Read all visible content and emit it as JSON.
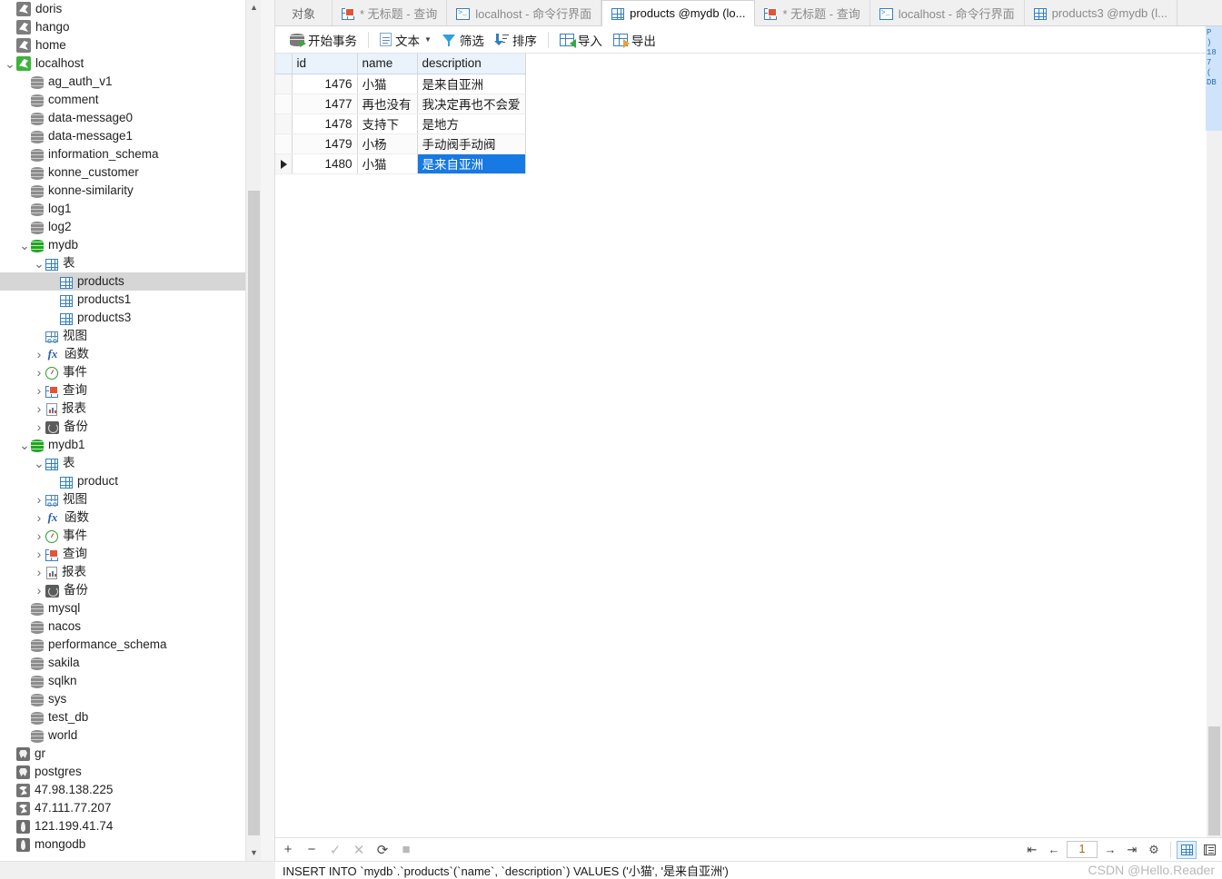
{
  "tree": {
    "items": [
      {
        "label": "doris",
        "depth": 0,
        "icon": "mysql-connection-icon",
        "twisty": ""
      },
      {
        "label": "hango",
        "depth": 0,
        "icon": "mysql-connection-icon",
        "twisty": ""
      },
      {
        "label": "home",
        "depth": 0,
        "icon": "mysql-connection-icon",
        "twisty": ""
      },
      {
        "label": "localhost",
        "depth": 0,
        "icon": "mysql-connection-active-icon",
        "twisty": "v"
      },
      {
        "label": "ag_auth_v1",
        "depth": 1,
        "icon": "database-icon",
        "twisty": ""
      },
      {
        "label": "comment",
        "depth": 1,
        "icon": "database-icon",
        "twisty": ""
      },
      {
        "label": "data-message0",
        "depth": 1,
        "icon": "database-icon",
        "twisty": ""
      },
      {
        "label": "data-message1",
        "depth": 1,
        "icon": "database-icon",
        "twisty": ""
      },
      {
        "label": "information_schema",
        "depth": 1,
        "icon": "database-icon",
        "twisty": ""
      },
      {
        "label": "konne_customer",
        "depth": 1,
        "icon": "database-icon",
        "twisty": ""
      },
      {
        "label": "konne-similarity",
        "depth": 1,
        "icon": "database-icon",
        "twisty": ""
      },
      {
        "label": "log1",
        "depth": 1,
        "icon": "database-icon",
        "twisty": ""
      },
      {
        "label": "log2",
        "depth": 1,
        "icon": "database-icon",
        "twisty": ""
      },
      {
        "label": "mydb",
        "depth": 1,
        "icon": "database-open-icon",
        "twisty": "v"
      },
      {
        "label": "表",
        "depth": 2,
        "icon": "table-folder-icon",
        "twisty": "v"
      },
      {
        "label": "products",
        "depth": 3,
        "icon": "table-icon",
        "twisty": "",
        "selected": true
      },
      {
        "label": "products1",
        "depth": 3,
        "icon": "table-icon",
        "twisty": ""
      },
      {
        "label": "products3",
        "depth": 3,
        "icon": "table-icon",
        "twisty": ""
      },
      {
        "label": "视图",
        "depth": 2,
        "icon": "view-icon",
        "twisty": ""
      },
      {
        "label": "函数",
        "depth": 2,
        "icon": "function-icon",
        "twisty": ">"
      },
      {
        "label": "事件",
        "depth": 2,
        "icon": "event-icon",
        "twisty": ">"
      },
      {
        "label": "查询",
        "depth": 2,
        "icon": "query-icon",
        "twisty": ">"
      },
      {
        "label": "报表",
        "depth": 2,
        "icon": "report-icon",
        "twisty": ">"
      },
      {
        "label": "备份",
        "depth": 2,
        "icon": "backup-icon",
        "twisty": ">"
      },
      {
        "label": "mydb1",
        "depth": 1,
        "icon": "database-open-icon",
        "twisty": "v"
      },
      {
        "label": "表",
        "depth": 2,
        "icon": "table-folder-icon",
        "twisty": "v"
      },
      {
        "label": "product",
        "depth": 3,
        "icon": "table-icon",
        "twisty": ""
      },
      {
        "label": "视图",
        "depth": 2,
        "icon": "view-icon",
        "twisty": ">"
      },
      {
        "label": "函数",
        "depth": 2,
        "icon": "function-icon",
        "twisty": ">"
      },
      {
        "label": "事件",
        "depth": 2,
        "icon": "event-icon",
        "twisty": ">"
      },
      {
        "label": "查询",
        "depth": 2,
        "icon": "query-icon",
        "twisty": ">"
      },
      {
        "label": "报表",
        "depth": 2,
        "icon": "report-icon",
        "twisty": ">"
      },
      {
        "label": "备份",
        "depth": 2,
        "icon": "backup-icon",
        "twisty": ">"
      },
      {
        "label": "mysql",
        "depth": 1,
        "icon": "database-icon",
        "twisty": ""
      },
      {
        "label": "nacos",
        "depth": 1,
        "icon": "database-icon",
        "twisty": ""
      },
      {
        "label": "performance_schema",
        "depth": 1,
        "icon": "database-icon",
        "twisty": ""
      },
      {
        "label": "sakila",
        "depth": 1,
        "icon": "database-icon",
        "twisty": ""
      },
      {
        "label": "sqlkn",
        "depth": 1,
        "icon": "database-icon",
        "twisty": ""
      },
      {
        "label": "sys",
        "depth": 1,
        "icon": "database-icon",
        "twisty": ""
      },
      {
        "label": "test_db",
        "depth": 1,
        "icon": "database-icon",
        "twisty": ""
      },
      {
        "label": "world",
        "depth": 1,
        "icon": "database-icon",
        "twisty": ""
      },
      {
        "label": "gr",
        "depth": 0,
        "icon": "postgresql-connection-icon",
        "twisty": ""
      },
      {
        "label": "postgres",
        "depth": 0,
        "icon": "postgresql-connection-icon",
        "twisty": ""
      },
      {
        "label": "47.98.138.225",
        "depth": 0,
        "icon": "sqlserver-connection-icon",
        "twisty": ""
      },
      {
        "label": "47.111.77.207",
        "depth": 0,
        "icon": "sqlserver-connection-icon",
        "twisty": ""
      },
      {
        "label": "121.199.41.74",
        "depth": 0,
        "icon": "mongodb-connection-icon",
        "twisty": ""
      },
      {
        "label": "mongodb",
        "depth": 0,
        "icon": "mongodb-connection-icon",
        "twisty": ""
      }
    ]
  },
  "tabs": {
    "object_label": "对象",
    "items": [
      {
        "label": "* 无标题 - 查询",
        "icon": "query-icon",
        "active": false,
        "star": true
      },
      {
        "label": "localhost - 命令行界面",
        "icon": "console-icon",
        "active": false
      },
      {
        "label": "products @mydb (lo...",
        "icon": "table-icon",
        "active": true
      },
      {
        "label": "* 无标题 - 查询",
        "icon": "query-icon",
        "active": false,
        "star": true
      },
      {
        "label": "localhost - 命令行界面",
        "icon": "console-icon",
        "active": false
      },
      {
        "label": "products3 @mydb (l...",
        "icon": "table-icon",
        "active": false
      }
    ]
  },
  "toolbar": {
    "begin_transaction": "开始事务",
    "text": "文本",
    "filter": "筛选",
    "sort": "排序",
    "import": "导入",
    "export": "导出"
  },
  "grid": {
    "columns": [
      "id",
      "name",
      "description"
    ],
    "rows": [
      {
        "id": "1476",
        "name": "小猫",
        "description": "是来自亚洲"
      },
      {
        "id": "1477",
        "name": "再也没有",
        "description": "我决定再也不会爱"
      },
      {
        "id": "1478",
        "name": "支持下",
        "description": "是地方"
      },
      {
        "id": "1479",
        "name": "小杨",
        "description": "手动阀手动阀"
      },
      {
        "id": "1480",
        "name": "小猫",
        "description": "是来自亚洲",
        "current": true,
        "selected_cell": "description"
      }
    ]
  },
  "right_dock": {
    "lines": [
      "P",
      ")",
      "18",
      "7",
      "(",
      "DB"
    ]
  },
  "record_bar": {
    "add_label": "+",
    "delete_label": "−",
    "confirm_label": "✓",
    "cancel_label": "✕",
    "refresh_label": "⟳",
    "stop_label": "■"
  },
  "navigation": {
    "first": "⇤",
    "prev": "←",
    "page": "1",
    "next": "→",
    "last": "⇥",
    "settings": "⚙",
    "grid_view": "grid-view-icon",
    "form_view": "form-view-icon"
  },
  "status": {
    "sql": "INSERT INTO `mydb`.`products`(`name`, `description`) VALUES ('小猫', '是来自亚洲')"
  },
  "watermark": {
    "text": "CSDN @Hello.Reader"
  },
  "colors": {
    "selection_blue": "#1779e4",
    "tree_selection_gray": "#d6d6d6",
    "header_blue": "#eaf2fb",
    "accent_blue": "#2f7fc4",
    "green": "#3db33d"
  }
}
